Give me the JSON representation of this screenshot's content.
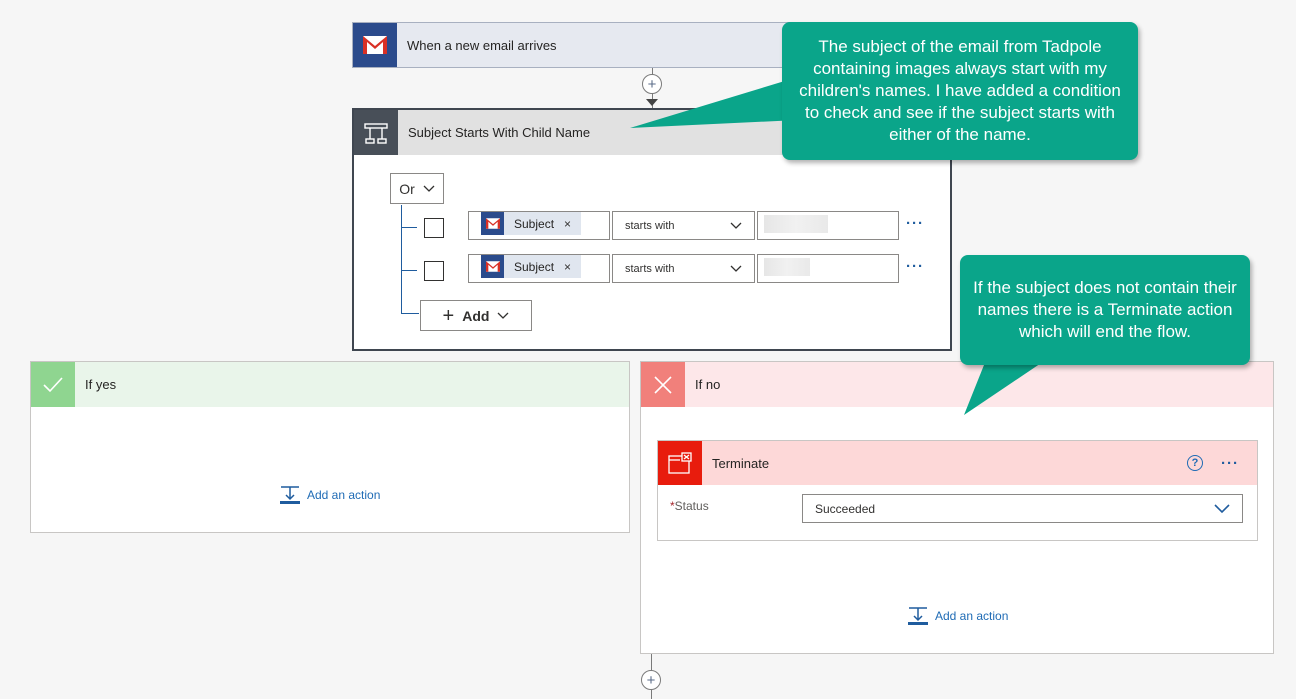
{
  "trigger": {
    "title": "When a new email arrives",
    "icon": "gmail-icon"
  },
  "condition": {
    "title": "Subject Starts With Child Name",
    "group_operator": "Or",
    "rows": [
      {
        "token": "Subject",
        "operator": "starts with"
      },
      {
        "token": "Subject",
        "operator": "starts with"
      }
    ],
    "add_label": "Add"
  },
  "branches": {
    "yes": {
      "title": "If yes",
      "add_action": "Add an action"
    },
    "no": {
      "title": "If no",
      "add_action": "Add an action",
      "terminate": {
        "title": "Terminate",
        "status_label": "Status",
        "status_required": "*",
        "status_value": "Succeeded"
      }
    }
  },
  "callouts": {
    "condition_note": "The subject of the email from Tadpole containing images always start with my children's names.  I have added a condition to check and see if the subject starts with either of the name.",
    "terminate_note": "If the subject does not contain their names there is a Terminate action which will end the flow."
  },
  "colors": {
    "callout": "#0aa58a",
    "gmail_tile": "#2b4b8c",
    "condition_tile": "#484f58",
    "yes_tile": "#8fd590",
    "no_tile": "#f1807b",
    "terminate_tile": "#e81c0d",
    "link": "#1f6bb5"
  }
}
